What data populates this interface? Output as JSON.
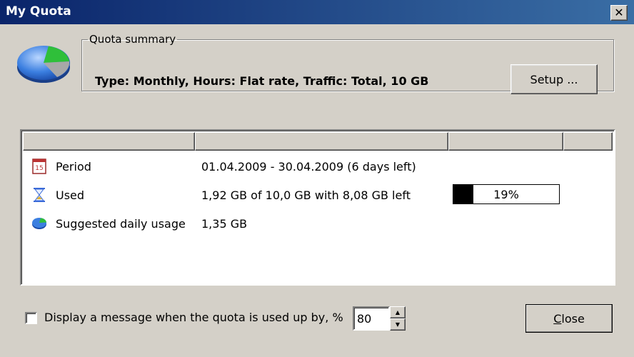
{
  "window": {
    "title": "My Quota"
  },
  "summary": {
    "legend": "Quota summary",
    "text": "Type: Monthly, Hours: Flat rate, Traffic: Total, 10 GB",
    "setup_label": "Setup ..."
  },
  "list": {
    "rows": [
      {
        "label": "Period",
        "value": "01.04.2009 - 30.04.2009 (6 days left)",
        "icon": "calendar-icon"
      },
      {
        "label": "Used",
        "value": "1,92 GB of 10,0 GB with 8,08 GB left",
        "icon": "hourglass-icon"
      },
      {
        "label": "Suggested daily usage",
        "value": "1,35 GB",
        "icon": "pie-chart-icon"
      }
    ],
    "progress": {
      "label": "19%",
      "fraction": 0.19
    }
  },
  "footer": {
    "checkbox_label": "Display a message when the quota is used up by, %",
    "checked": false,
    "percent_value": "80",
    "close_label_first": "C",
    "close_label_rest": "lose"
  },
  "colors": {
    "titlebar_start": "#0a246a",
    "titlebar_end": "#3a6ea5",
    "dialog_bg": "#d4d0c8"
  }
}
